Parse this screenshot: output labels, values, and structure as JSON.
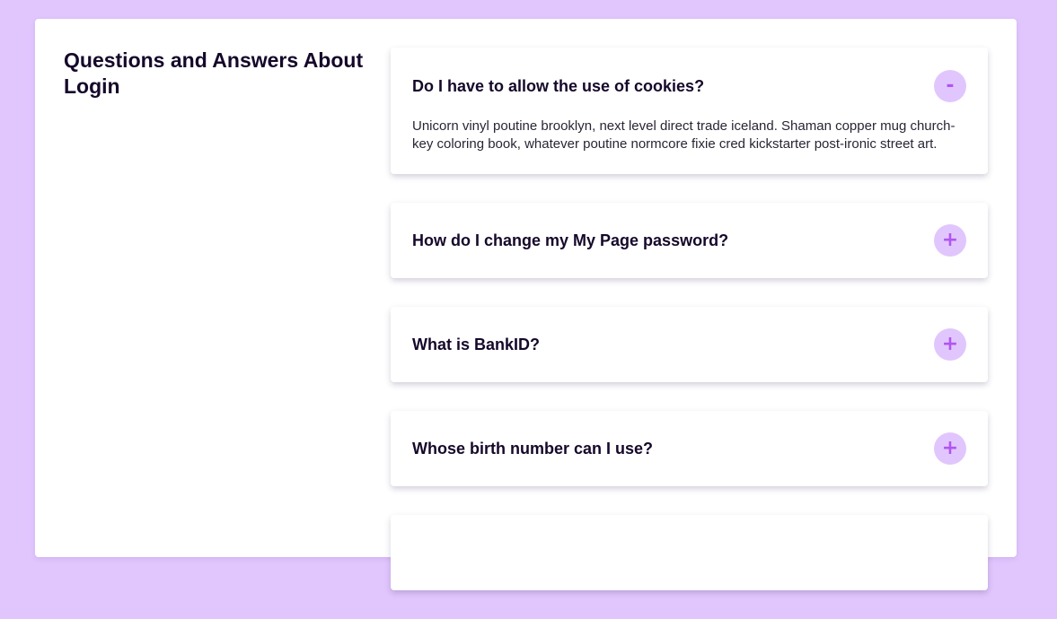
{
  "page": {
    "title": "Questions and Answers About Login"
  },
  "faq": [
    {
      "question": "Do I have to allow the use of cookies?",
      "answer": "Unicorn vinyl poutine brooklyn, next level direct trade iceland. Shaman copper mug church-key coloring book, whatever poutine normcore fixie cred kickstarter post-ironic street art.",
      "expanded": true,
      "toggle_symbol": "-"
    },
    {
      "question": "How do I change my My Page password?",
      "expanded": false,
      "toggle_symbol": "+"
    },
    {
      "question": "What is BankID?",
      "expanded": false,
      "toggle_symbol": "+"
    },
    {
      "question": "Whose birth number can I use?",
      "expanded": false,
      "toggle_symbol": "+"
    }
  ],
  "colors": {
    "background": "#e1c6fd",
    "accent": "#b155f2",
    "card": "#ffffff",
    "text": "#15082a"
  }
}
